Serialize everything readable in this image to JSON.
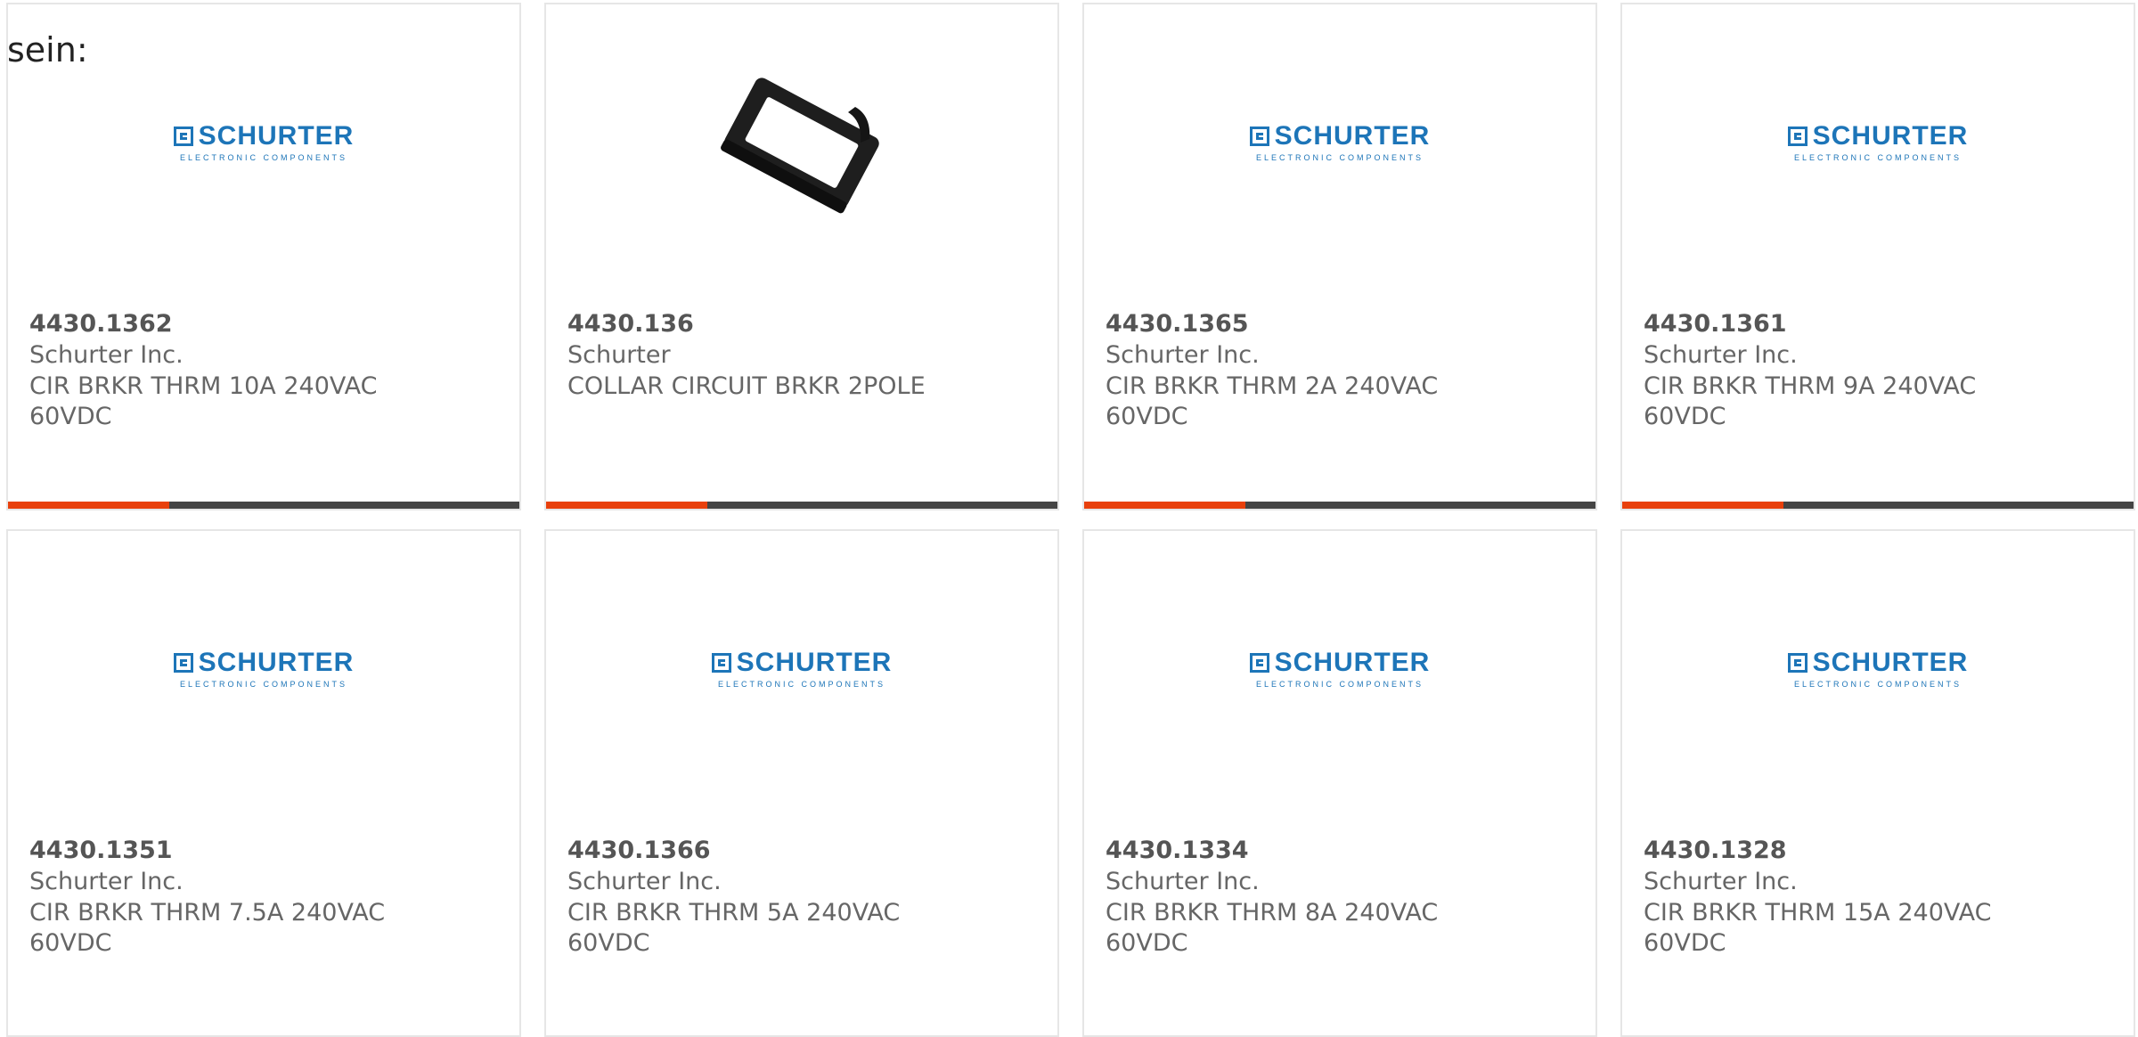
{
  "intro_text": "sein:",
  "brand": {
    "logo_word": "SCHURTER",
    "logo_sub": "ELECTRONIC COMPONENTS",
    "logo_color": "#1d75b8",
    "accent_color": "#e8400c"
  },
  "products": [
    {
      "part_number": "4430.1362",
      "manufacturer": "Schurter Inc.",
      "description": "CIR BRKR THRM 10A 240VAC 60VDC",
      "image": "schurter-logo"
    },
    {
      "part_number": "4430.136",
      "manufacturer": "Schurter",
      "description": "COLLAR CIRCUIT BRKR 2POLE",
      "image": "collar-photo"
    },
    {
      "part_number": "4430.1365",
      "manufacturer": "Schurter Inc.",
      "description": "CIR BRKR THRM 2A 240VAC 60VDC",
      "image": "schurter-logo"
    },
    {
      "part_number": "4430.1361",
      "manufacturer": "Schurter Inc.",
      "description": "CIR BRKR THRM 9A 240VAC 60VDC",
      "image": "schurter-logo"
    },
    {
      "part_number": "4430.1351",
      "manufacturer": "Schurter Inc.",
      "description": "CIR BRKR THRM 7.5A 240VAC 60VDC",
      "image": "schurter-logo"
    },
    {
      "part_number": "4430.1366",
      "manufacturer": "Schurter Inc.",
      "description": "CIR BRKR THRM 5A 240VAC 60VDC",
      "image": "schurter-logo"
    },
    {
      "part_number": "4430.1334",
      "manufacturer": "Schurter Inc.",
      "description": "CIR BRKR THRM 8A 240VAC 60VDC",
      "image": "schurter-logo"
    },
    {
      "part_number": "4430.1328",
      "manufacturer": "Schurter Inc.",
      "description": "CIR BRKR THRM 15A 240VAC 60VDC",
      "image": "schurter-logo"
    }
  ]
}
